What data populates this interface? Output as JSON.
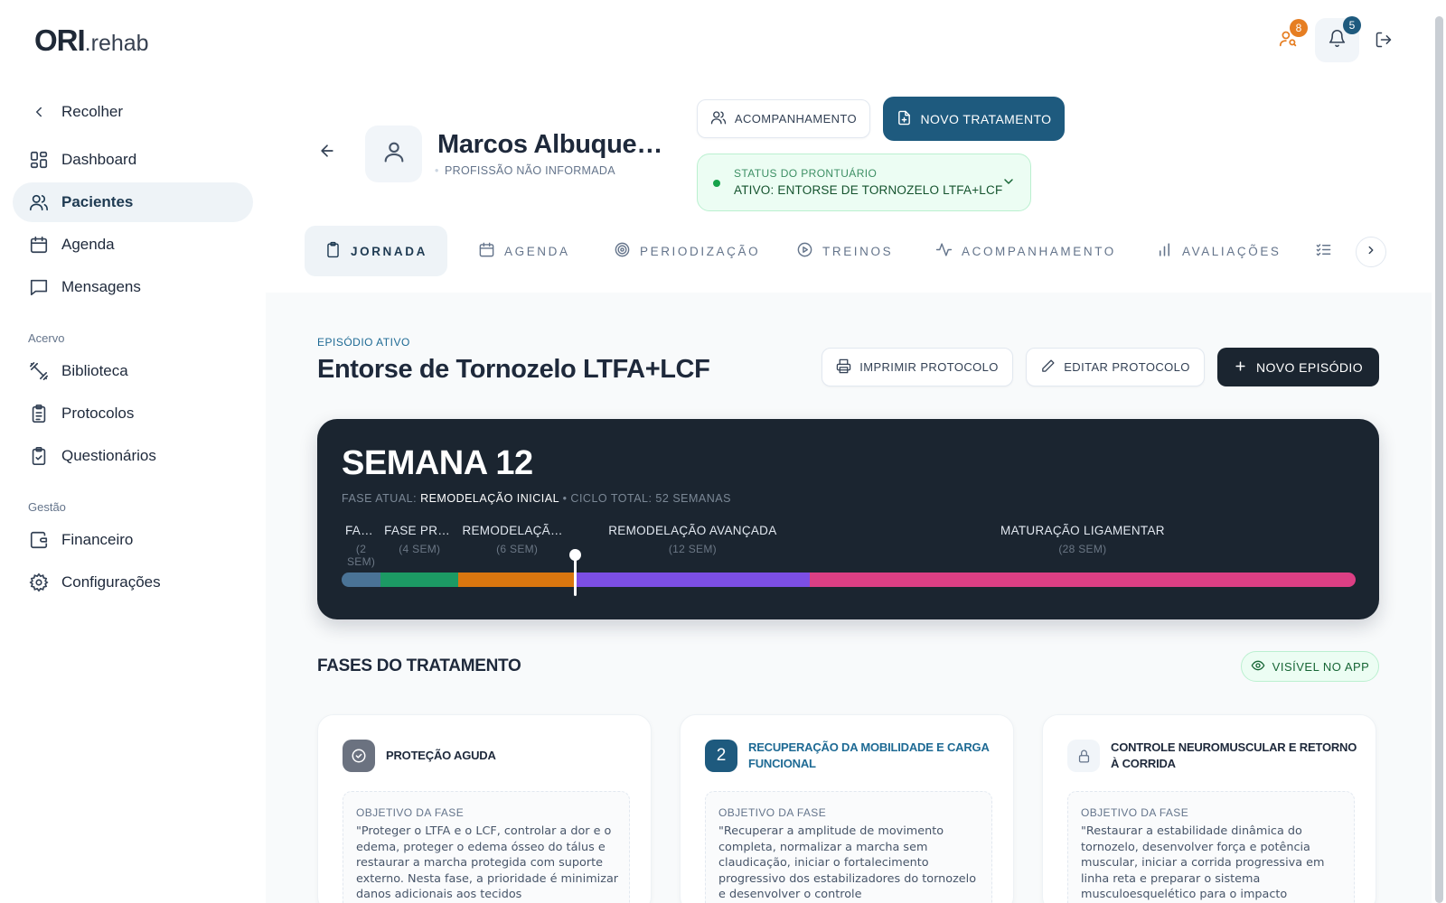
{
  "app": {
    "logo_main": "ORI",
    "logo_suffix": ".rehab"
  },
  "sidebar": {
    "collapse_label": "Recolher",
    "items": [
      {
        "label": "Dashboard",
        "icon": "dashboard-icon"
      },
      {
        "label": "Pacientes",
        "icon": "users-icon",
        "active": true
      },
      {
        "label": "Agenda",
        "icon": "calendar-icon"
      },
      {
        "label": "Mensagens",
        "icon": "message-icon"
      }
    ],
    "section_acervo": "Acervo",
    "acervo_items": [
      {
        "label": "Biblioteca",
        "icon": "dumbbell-icon"
      },
      {
        "label": "Protocolos",
        "icon": "clipboard-list-icon"
      },
      {
        "label": "Questionários",
        "icon": "clipboard-check-icon"
      }
    ],
    "section_gestao": "Gestão",
    "gestao_items": [
      {
        "label": "Financeiro",
        "icon": "wallet-icon"
      },
      {
        "label": "Configurações",
        "icon": "gear-icon"
      }
    ]
  },
  "topbar": {
    "requests_badge": "8",
    "notifications_badge": "5",
    "requests_badge_color": "#e67e22",
    "notifications_badge_color": "#1e5a7e"
  },
  "patient": {
    "name": "Marcos Albuquerque",
    "profession": "PROFISSÃO NÃO INFORMADA"
  },
  "actions": {
    "follow_up": "ACOMPANHAMENTO",
    "new_treatment": "NOVO TRATAMENTO"
  },
  "status": {
    "label": "STATUS DO PRONTUÁRIO",
    "value": "ATIVO: ENTORSE DE TORNOZELO LTFA+LCF"
  },
  "tabs": [
    {
      "label": "JORNADA",
      "icon": "clipboard-icon",
      "active": true
    },
    {
      "label": "AGENDA",
      "icon": "calendar-icon"
    },
    {
      "label": "PERIODIZAÇÃO",
      "icon": "target-icon"
    },
    {
      "label": "TREINOS",
      "icon": "play-circle-icon"
    },
    {
      "label": "ACOMPANHAMENTO",
      "icon": "activity-icon"
    },
    {
      "label": "AVALIAÇÕES",
      "icon": "bar-chart-icon"
    }
  ],
  "episode": {
    "label": "EPISÓDIO ATIVO",
    "title": "Entorse de Tornozelo LTFA+LCF",
    "print_btn": "IMPRIMIR PROTOCOLO",
    "edit_btn": "EDITAR PROTOCOLO",
    "new_btn": "NOVO EPISÓDIO"
  },
  "progress": {
    "week_title": "SEMANA 12",
    "phase_prefix": "FASE ATUAL:",
    "phase_current": "REMODELAÇÃO INICIAL",
    "cycle_text": "• CICLO TOTAL: 52 SEMANAS",
    "current_week": 12,
    "total_weeks": 52,
    "phases": [
      {
        "label": "FASE DE PROTEÇÃO",
        "duration": "(2 SEM)",
        "weeks": 2,
        "color": "#4a7396"
      },
      {
        "label": "FASE PROLIFERATIVA",
        "duration": "(4 SEM)",
        "weeks": 4,
        "color": "#1c9a64"
      },
      {
        "label": "REMODELAÇÃO INICIAL",
        "duration": "(6 SEM)",
        "weeks": 6,
        "color": "#d9760f"
      },
      {
        "label": "REMODELAÇÃO AVANÇADA",
        "duration": "(12 SEM)",
        "weeks": 12,
        "color": "#7c4ee4"
      },
      {
        "label": "MATURAÇÃO LIGAMENTAR",
        "duration": "(28 SEM)",
        "weeks": 28,
        "color": "#dc3f84"
      }
    ]
  },
  "phases_section": {
    "title": "FASES DO TRATAMENTO",
    "visible_pill": "VISÍVEL NO APP",
    "objective_label": "OBJETIVO DA FASE",
    "cards": [
      {
        "icon_text": "",
        "title": "PROTEÇÃO AGUDA",
        "title_color": "#1e293b",
        "icon_bg": "#6b7280",
        "objective": "\"Proteger o LTFA e o LCF, controlar a dor e o edema, proteger o edema ósseo do tálus e restaurar a marcha protegida com suporte externo. Nesta fase, a prioridade é minimizar danos adicionais aos tecidos"
      },
      {
        "icon_text": "2",
        "title": "RECUPERAÇÃO DA MOBILIDADE E CARGA FUNCIONAL",
        "title_color": "#1e6a94",
        "icon_bg": "#1e5a7e",
        "objective": "\"Recuperar a amplitude de movimento completa, normalizar a marcha sem claudicação, iniciar o fortalecimento progressivo dos estabilizadores do tornozelo e desenvolver o controle"
      },
      {
        "icon_text": "",
        "title": "CONTROLE NEUROMUSCULAR E RETORNO À CORRIDA",
        "title_color": "#1e293b",
        "icon_bg": "#f1f5f9",
        "objective": "\"Restaurar a estabilidade dinâmica do tornozelo, desenvolver força e potência muscular, iniciar a corrida progressiva em linha reta e preparar o sistema musculoesquelético para o impacto"
      }
    ]
  }
}
